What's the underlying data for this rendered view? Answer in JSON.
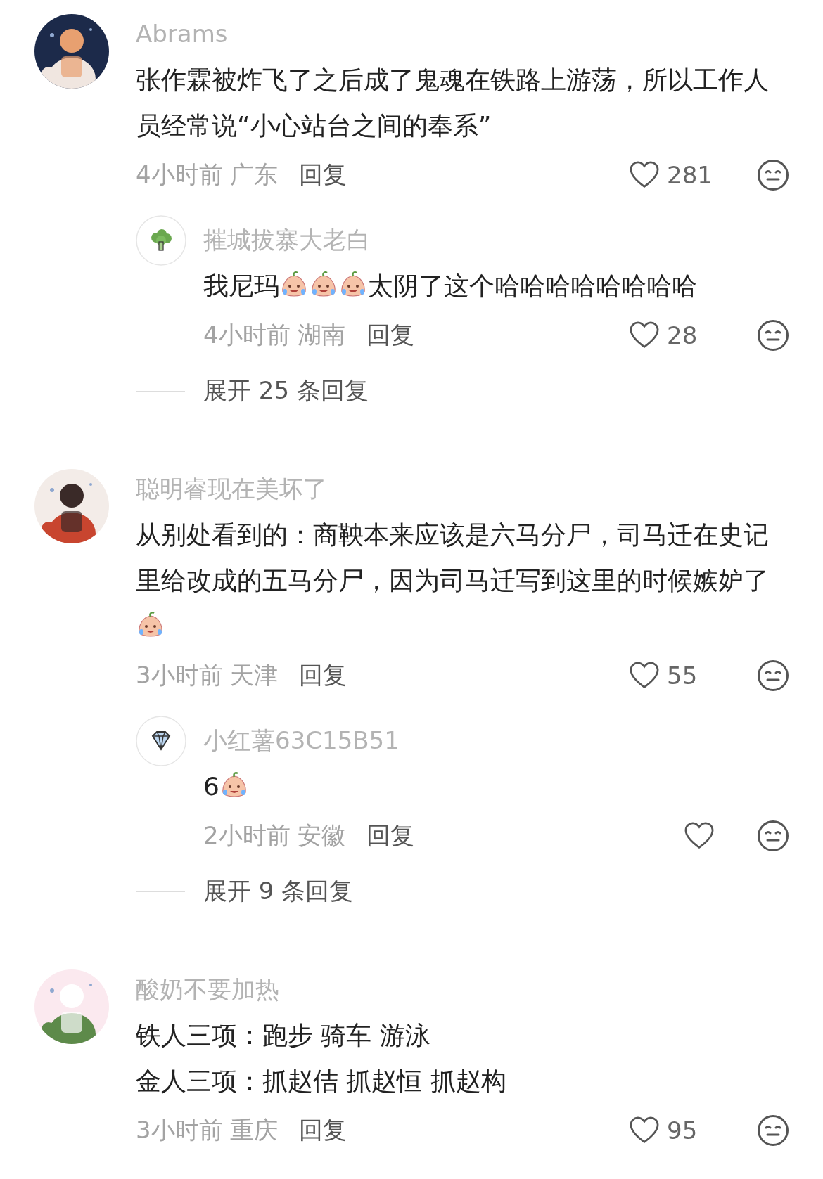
{
  "comments": [
    {
      "author": "Abrams",
      "avatar": {
        "kind": "picture"
      },
      "body": [
        {
          "kind": "text",
          "text": "张作霖被炸飞了之后成了鬼魂在铁路上游荡，所以工作人员经常说“小心站台之间的奉系”"
        }
      ],
      "time": "4小时前",
      "location": "广东",
      "reply_label": "回复",
      "likes": "281",
      "replies": [
        {
          "author": "摧城拔寨大老白",
          "body": [
            {
              "kind": "text",
              "text": "我尼玛"
            },
            {
              "kind": "emoji"
            },
            {
              "kind": "emoji"
            },
            {
              "kind": "emoji"
            },
            {
              "kind": "text",
              "text": "太阴了这个哈哈哈哈哈哈哈哈"
            }
          ],
          "time": "4小时前",
          "location": "湖南",
          "reply_label": "回复",
          "likes": "28"
        }
      ],
      "expand_label": "展开 25 条回复"
    },
    {
      "author": "聪明睿现在美坏了",
      "avatar": {
        "kind": "picture"
      },
      "body": [
        {
          "kind": "text",
          "text": "从别处看到的：商鞅本来应该是六马分尸，司马迁在史记里给改成的五马分尸，因为司马迁写到这里的时候嫉妒了"
        },
        {
          "kind": "emoji"
        }
      ],
      "time": "3小时前",
      "location": "天津",
      "reply_label": "回复",
      "likes": "55",
      "replies": [
        {
          "author": "小红薯63C15B51",
          "body": [
            {
              "kind": "text",
              "text": "6"
            },
            {
              "kind": "emoji"
            }
          ],
          "time": "2小时前",
          "location": "安徽",
          "reply_label": "回复"
        }
      ],
      "expand_label": "展开 9 条回复"
    },
    {
      "author": "酸奶不要加热",
      "avatar": {
        "kind": "picture"
      },
      "body": [
        {
          "kind": "text",
          "text": "铁人三项：跑步 骑车 游泳"
        },
        {
          "kind": "break"
        },
        {
          "kind": "text",
          "text": "金人三项：抓赵佶 抓赵恒 抓赵构"
        }
      ],
      "time": "3小时前",
      "location": "重庆",
      "reply_label": "回复",
      "likes": "95"
    }
  ]
}
